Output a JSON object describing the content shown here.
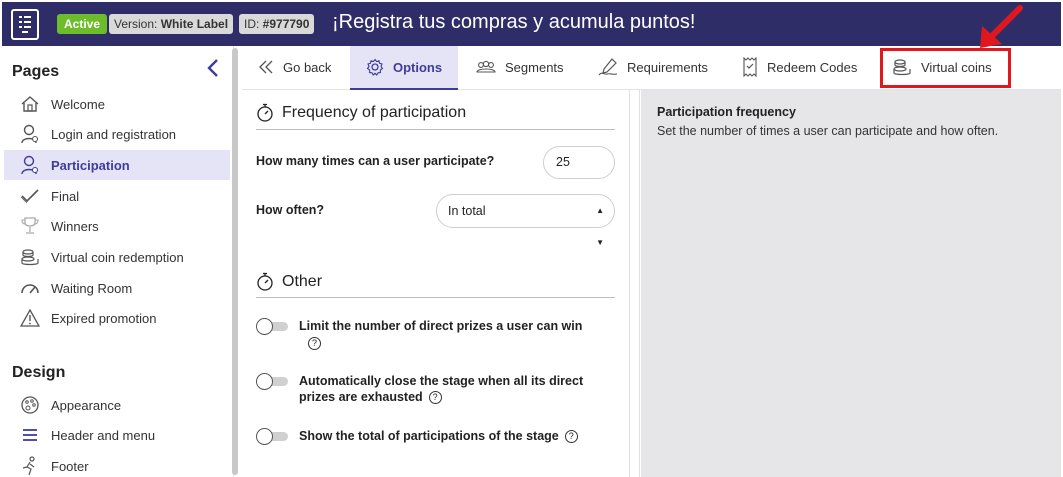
{
  "topbar": {
    "logo_icon": "form-doc-icon",
    "status_badge": "Active",
    "version_label": "Version: ",
    "version_value": "White Label",
    "id_label": "ID: ",
    "id_value": "#977790",
    "title": "¡Registra tus compras y acumula puntos!"
  },
  "sidebar": {
    "pages_heading": "Pages",
    "items": [
      {
        "label": "Welcome",
        "icon": "home-icon"
      },
      {
        "label": "Login and registration",
        "icon": "user-icon"
      },
      {
        "label": "Participation",
        "icon": "user-check-icon",
        "active": true
      },
      {
        "label": "Final",
        "icon": "checkmark-icon"
      },
      {
        "label": "Winners",
        "icon": "trophy-icon"
      },
      {
        "label": "Virtual coin redemption",
        "icon": "coins-icon"
      },
      {
        "label": "Waiting Room",
        "icon": "gauge-icon"
      },
      {
        "label": "Expired promotion",
        "icon": "warning-icon"
      }
    ],
    "design_heading": "Design",
    "design_items": [
      {
        "label": "Appearance",
        "icon": "palette-icon"
      },
      {
        "label": "Header and menu",
        "icon": "menu-icon"
      },
      {
        "label": "Footer",
        "icon": "footer-icon"
      }
    ]
  },
  "tabs": [
    {
      "label": "Go back",
      "icon": "double-chevron-left-icon"
    },
    {
      "label": "Options",
      "icon": "gear-icon",
      "active": true
    },
    {
      "label": "Segments",
      "icon": "group-icon"
    },
    {
      "label": "Requirements",
      "icon": "signature-icon"
    },
    {
      "label": "Redeem Codes",
      "icon": "receipt-icon"
    },
    {
      "label": "Virtual coins",
      "icon": "coins-icon",
      "highlighted": true
    }
  ],
  "form": {
    "section1_title": "Frequency of participation",
    "times_label": "How many times can a user participate?",
    "times_value": "25",
    "how_often_label": "How often?",
    "how_often_value": "In total",
    "section2_title": "Other",
    "toggles": [
      {
        "label": "Limit the number of direct prizes a user can win",
        "on": false
      },
      {
        "label": "Automatically close the stage when all its direct prizes are exhausted",
        "on": false
      },
      {
        "label": "Show the total of participations of the stage",
        "on": false
      }
    ],
    "help_glyph": "?"
  },
  "help_panel": {
    "title": "Participation frequency",
    "description": "Set the number of times a user can participate and how often."
  },
  "colors": {
    "topbar_bg": "#2f2d68",
    "accent": "#3f3c9c",
    "active_bg": "#e5e4f7",
    "status_green": "#6dbd2b",
    "highlight_red": "#e0181d"
  }
}
